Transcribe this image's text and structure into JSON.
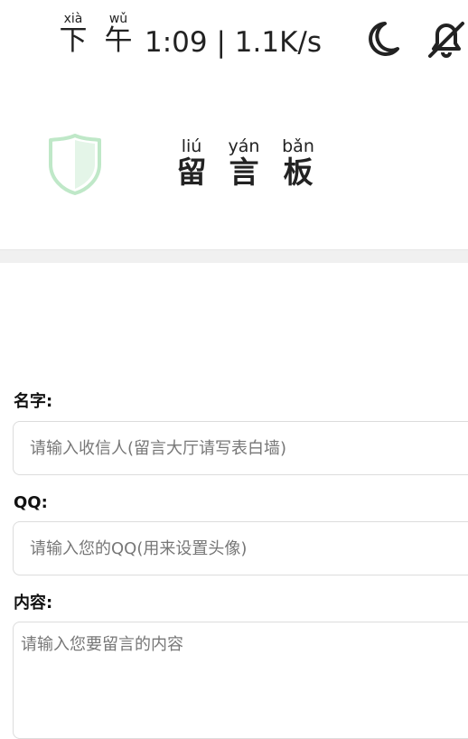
{
  "status_bar": {
    "time_chars": [
      {
        "pinyin": "xià",
        "han": "下"
      },
      {
        "pinyin": "wǔ",
        "han": "午"
      }
    ],
    "time": "1:09",
    "network_speed": "1.1K/s",
    "icons": [
      "moon-icon",
      "bell-muted-icon"
    ]
  },
  "header": {
    "logo_icon": "shield-icon",
    "title_chars": [
      {
        "pinyin": "liú",
        "han": "留"
      },
      {
        "pinyin": "yán",
        "han": "言"
      },
      {
        "pinyin": "bǎn",
        "han": "板"
      }
    ]
  },
  "form": {
    "name_label": "名字:",
    "name_placeholder": "请输入收信人(留言大厅请写表白墙)",
    "qq_label": "QQ:",
    "qq_placeholder": "请输入您的QQ(用来设置头像)",
    "content_label": "内容:",
    "content_placeholder": "请输入您要留言的内容"
  },
  "colors": {
    "shield_stroke": "#bfe8c8",
    "shield_fill": "#e4f5e8",
    "divider": "#f0f0f0",
    "input_border": "#dcdcdc"
  }
}
